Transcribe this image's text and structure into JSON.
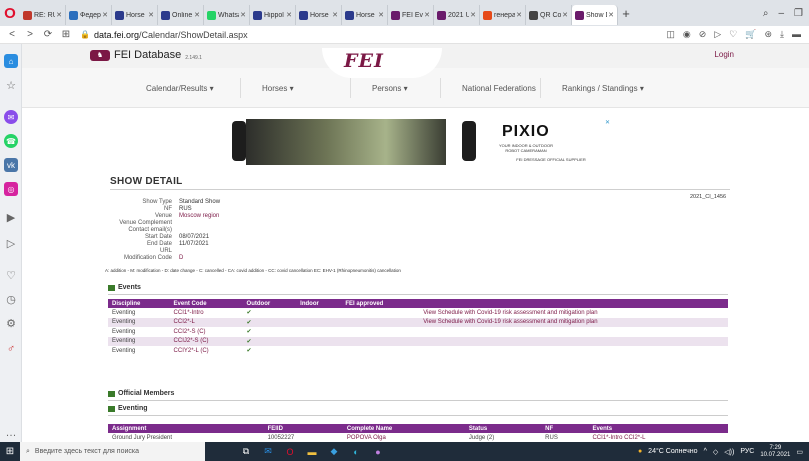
{
  "browser": {
    "tabs": [
      {
        "label": "RE: RU",
        "color": "#c0382b"
      },
      {
        "label": "Федера",
        "color": "#2a6ebd"
      },
      {
        "label": "Horse",
        "color": "#2b3a8c"
      },
      {
        "label": "Online",
        "color": "#2b3a8c"
      },
      {
        "label": "Whatsa",
        "color": "#25d366"
      },
      {
        "label": "Hippol",
        "color": "#2b3a8c"
      },
      {
        "label": "Horse",
        "color": "#2b3a8c"
      },
      {
        "label": "Horse",
        "color": "#2b3a8c"
      },
      {
        "label": "FEI Eve",
        "color": "#6a1b6b"
      },
      {
        "label": "2021 U",
        "color": "#6a1b6b"
      },
      {
        "label": "генера",
        "color": "#e64a19"
      },
      {
        "label": "QR Co",
        "color": "#444444"
      },
      {
        "label": "Show D",
        "color": "#6a1b6b"
      }
    ],
    "url_domain": "data.fei.org",
    "url_path": "/Calendar/ShowDetail.aspx"
  },
  "site": {
    "brand": "FEI Database",
    "version": "2.149.1",
    "logo": "FEI",
    "login": "Login",
    "menu": [
      {
        "label": "Calendar/Results",
        "dropdown": true
      },
      {
        "label": "Horses",
        "dropdown": true
      },
      {
        "label": "Persons",
        "dropdown": true
      },
      {
        "label": "National Federations",
        "dropdown": false
      },
      {
        "label": "Rankings / Standings",
        "dropdown": true
      }
    ]
  },
  "ad": {
    "brand": "PIXIO",
    "sub": "YOUR INDOOR & OUTDOOR ROBOT CAMERAMAN",
    "supplier": "FEI DRESSAGE OFFICIAL SUPPLIER"
  },
  "show": {
    "section_title": "SHOW DETAIL",
    "code": "2021_CI_1456",
    "labels": [
      "Show Type",
      "NF",
      "Venue",
      "Venue Complement",
      "Contact email(s)",
      "Start Date",
      "End Date",
      "URL",
      "Modification Code"
    ],
    "values": [
      "Standard Show",
      "RUS",
      "Moscow region",
      "",
      "",
      "08/07/2021",
      "11/07/2021",
      "",
      "D"
    ],
    "legend": "A: addition - M: modification - D: date change - C: cancelled - CA: covid addition - CC: covid cancellation EC: EHV-1 (Rhinopneumonitis) cancellation"
  },
  "events": {
    "title": "Events",
    "headers": [
      "Discipline",
      "Event Code",
      "Outdoor",
      "Indoor",
      "FEI approved",
      ""
    ],
    "rows": [
      [
        "Eventing",
        "CCI1*-Intro",
        "✔",
        "",
        "",
        "View Schedule with Covid-19 risk assessment and mitigation plan"
      ],
      [
        "Eventing",
        "CCI2*-L",
        "✔",
        "",
        "",
        "View Schedule with Covid-19 risk assessment and mitigation plan"
      ],
      [
        "Eventing",
        "CCI2*-S (C)",
        "✔",
        "",
        "",
        ""
      ],
      [
        "Eventing",
        "CCIJ2*-S (C)",
        "✔",
        "",
        "",
        ""
      ],
      [
        "Eventing",
        "CCIY2*-L (C)",
        "✔",
        "",
        "",
        ""
      ]
    ]
  },
  "officials": {
    "title": "Official Members",
    "subtitle": "Eventing",
    "headers": [
      "Assignment",
      "FEIID",
      "Complete Name",
      "Status",
      "NF",
      "Events"
    ],
    "rows": [
      [
        "Ground Jury President",
        "10052227",
        "POPOVA Olga",
        "Judge (2)",
        "RUS",
        "CCI1*-Intro  CCI2*-L"
      ]
    ]
  },
  "taskbar": {
    "search_placeholder": "Введите здесь текст для поиска",
    "weather": "24°C Солнечно",
    "lang": "РУС",
    "time": "7:29",
    "date": "10.07.2021"
  }
}
